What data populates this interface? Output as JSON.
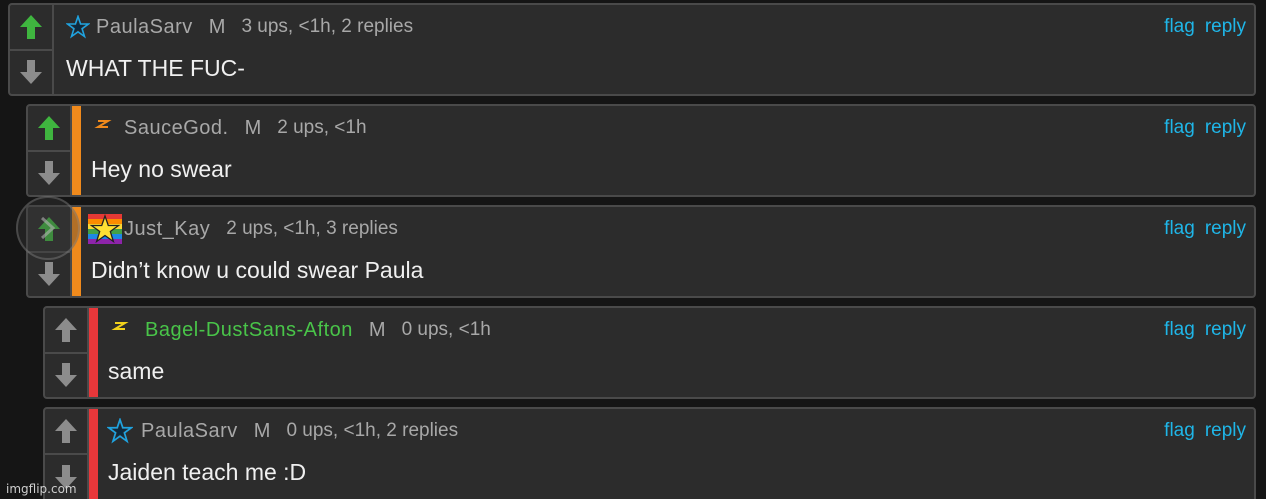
{
  "colors": {
    "upvoted": "#3fb53f",
    "arrow_default": "#8c8c8c",
    "link": "#1fb6e8",
    "depth1": "#f08a1c",
    "depth2": "#e8373a",
    "username_green": "#49c449",
    "username_default": "#a8a8a8"
  },
  "comments": [
    {
      "username": "PaulaSarv",
      "gender": "M",
      "meta": "3 ups, <1h, 2 replies",
      "text": "WHAT THE FUC-",
      "badge": "blue-star-icon",
      "upvoted": true,
      "flag": "flag",
      "reply": "reply"
    },
    {
      "username": "SauceGod.",
      "gender": "M",
      "meta": "2 ups, <1h",
      "text": "Hey no swear",
      "badge": "orange-bolt-icon",
      "upvoted": true,
      "flag": "flag",
      "reply": "reply"
    },
    {
      "username": "Just_Kay",
      "gender": "",
      "meta": "2 ups, <1h, 3 replies",
      "text": "Didn’t know u could swear Paula",
      "badge": "rainbow-star-icon",
      "upvoted": true,
      "flag": "flag",
      "reply": "reply"
    },
    {
      "username": "Bagel-DustSans-Afton",
      "gender": "M",
      "meta": "0 ups, <1h",
      "text": "same",
      "badge": "yellow-bolt-icon",
      "upvoted": false,
      "flag": "flag",
      "reply": "reply"
    },
    {
      "username": "PaulaSarv",
      "gender": "M",
      "meta": "0 ups, <1h, 2 replies",
      "text": "Jaiden teach me :D",
      "badge": "blue-star-icon",
      "upvoted": false,
      "flag": "flag",
      "reply": "reply"
    }
  ],
  "watermark": "imgflip.com"
}
